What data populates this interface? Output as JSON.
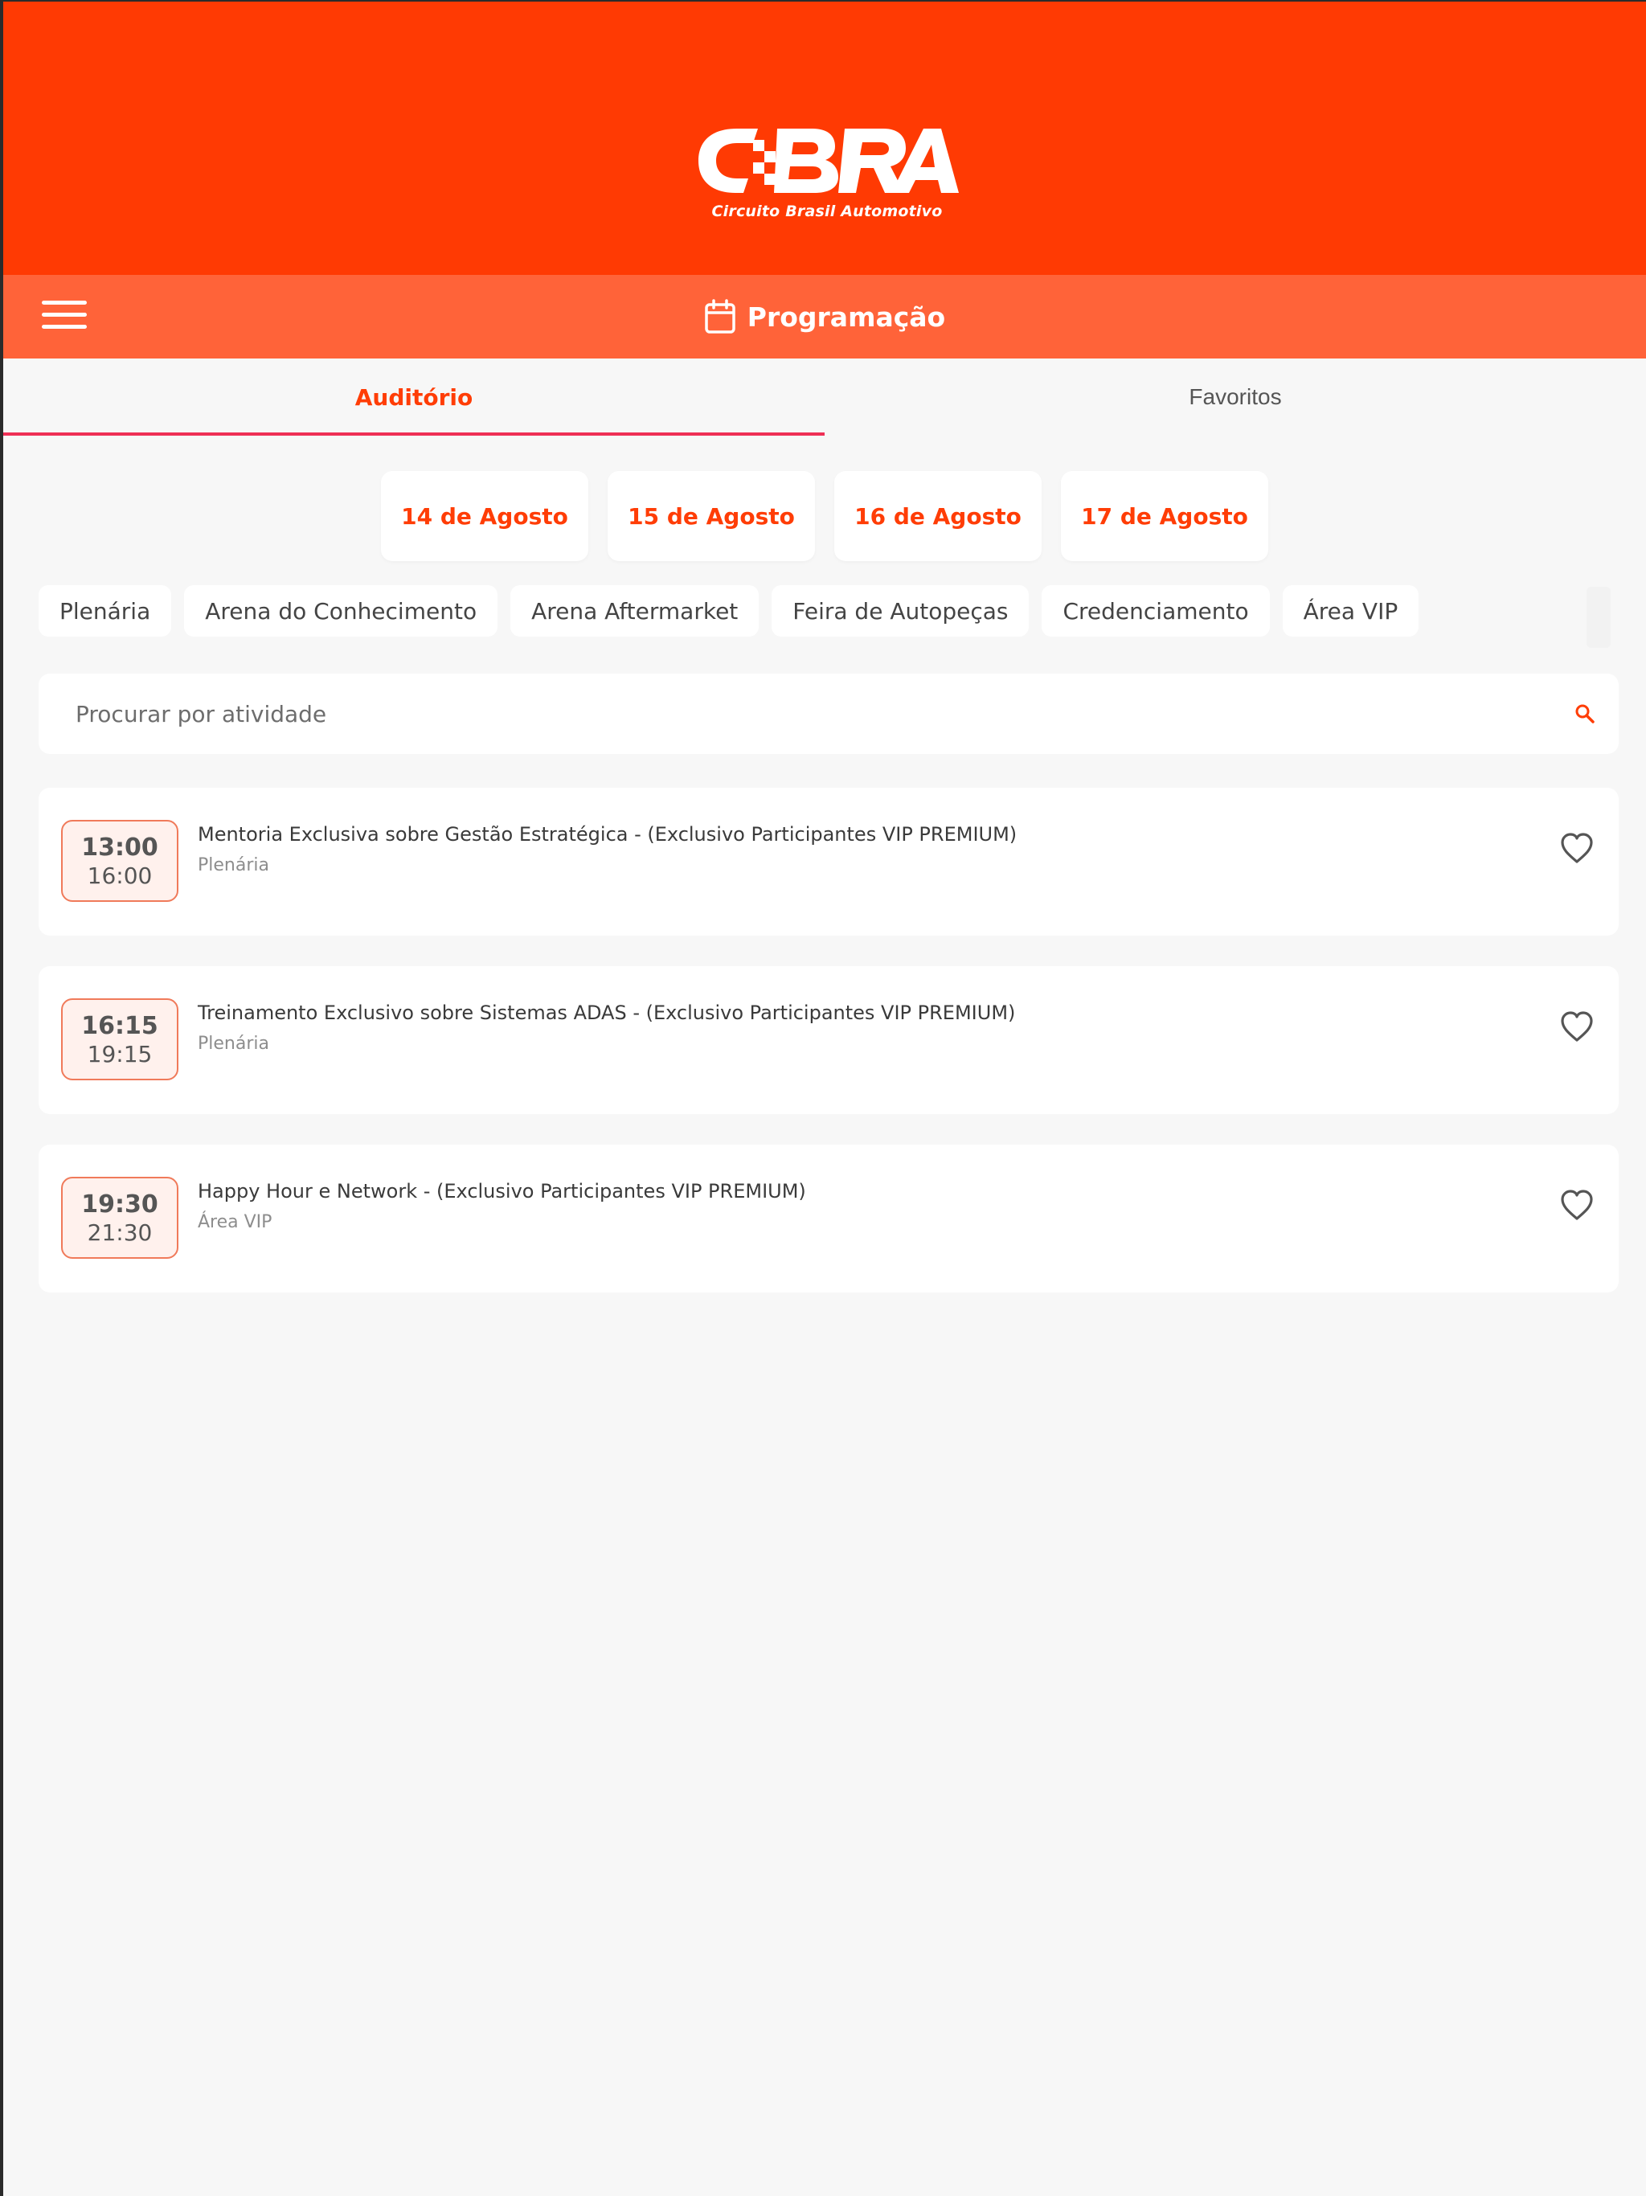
{
  "colors": {
    "brand": "#ff3a03",
    "toolbar": "#ff6339",
    "accent": "#ff3d06",
    "tab_underline": "#ee2f55",
    "background": "#f7f7f7"
  },
  "header": {
    "logo_text": "CBRA",
    "logo_subtitle": "Circuito Brasil Automotivo"
  },
  "toolbar": {
    "menu_icon": "hamburger-menu-icon",
    "title_icon": "calendar-icon",
    "title": "Programação"
  },
  "tabs": [
    {
      "label": "Auditório",
      "active": true
    },
    {
      "label": "Favoritos",
      "active": false
    }
  ],
  "dates": [
    {
      "label": "14 de Agosto"
    },
    {
      "label": "15 de Agosto"
    },
    {
      "label": "16 de Agosto"
    },
    {
      "label": "17 de Agosto"
    }
  ],
  "locations": [
    {
      "label": "Plenária"
    },
    {
      "label": "Arena do Conhecimento"
    },
    {
      "label": "Arena Aftermarket"
    },
    {
      "label": "Feira de Autopeças"
    },
    {
      "label": "Credenciamento"
    },
    {
      "label": "Área VIP"
    }
  ],
  "search": {
    "placeholder": "Procurar por atividade",
    "value": "",
    "icon": "search-icon"
  },
  "activities": [
    {
      "start": "13:00",
      "end": "16:00",
      "title": "Mentoria Exclusiva sobre Gestão Estratégica - (Exclusivo Participantes VIP PREMIUM)",
      "location": "Plenária",
      "favorite_icon": "heart-outline-icon"
    },
    {
      "start": "16:15",
      "end": "19:15",
      "title": "Treinamento Exclusivo sobre Sistemas ADAS - (Exclusivo Participantes VIP PREMIUM)",
      "location": "Plenária",
      "favorite_icon": "heart-outline-icon"
    },
    {
      "start": "19:30",
      "end": "21:30",
      "title": "Happy Hour e Network - (Exclusivo Participantes VIP PREMIUM)",
      "location": "Área VIP",
      "favorite_icon": "heart-outline-icon"
    }
  ]
}
